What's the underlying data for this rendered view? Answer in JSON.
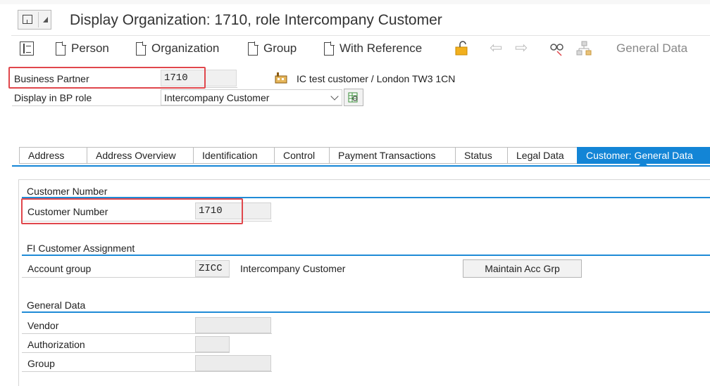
{
  "window": {
    "title": "Display Organization: 1710, role Intercompany Customer"
  },
  "toolbar": {
    "person_label": "Person",
    "organization_label": "Organization",
    "group_label": "Group",
    "with_reference_label": "With Reference",
    "general_data_label": "General Data"
  },
  "header": {
    "business_partner_label": "Business Partner",
    "business_partner_value": "1710",
    "bp_description": "IC test customer / London TW3 1CN",
    "display_role_label": "Display in BP role",
    "display_role_value": "Intercompany Customer"
  },
  "tabs": [
    {
      "label": "Address"
    },
    {
      "label": "Address Overview"
    },
    {
      "label": "Identification"
    },
    {
      "label": "Control"
    },
    {
      "label": "Payment Transactions"
    },
    {
      "label": "Status"
    },
    {
      "label": "Legal Data"
    },
    {
      "label": "Customer: General Data",
      "active": true
    }
  ],
  "customer_number_group": {
    "title": "Customer Number",
    "field_label": "Customer Number",
    "field_value": "1710"
  },
  "fi_assignment_group": {
    "title": "FI Customer Assignment",
    "account_group_label": "Account group",
    "account_group_value": "ZICC",
    "account_group_text": "Intercompany Customer",
    "maintain_button": "Maintain Acc Grp"
  },
  "general_data_group": {
    "title": "General Data",
    "vendor_label": "Vendor",
    "vendor_value": "",
    "authorization_label": "Authorization",
    "authorization_value": "",
    "group_label": "Group",
    "group_value": ""
  },
  "colors": {
    "accent": "#1385d6",
    "highlight_box": "#e0474c"
  }
}
